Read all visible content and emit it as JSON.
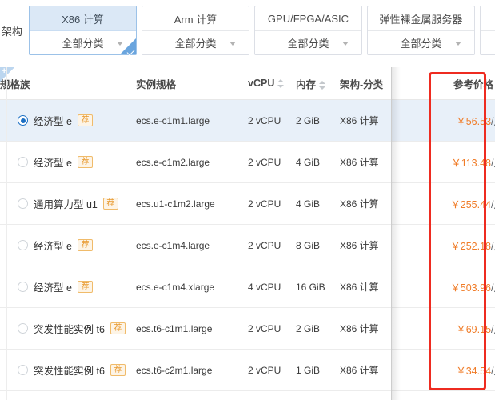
{
  "arch_filter": {
    "row_label": "架构",
    "cards": [
      {
        "title": "X86 计算",
        "category_label": "全部分类",
        "selected": true,
        "caret_icon": "chevron-down-icon"
      },
      {
        "title": "Arm 计算",
        "category_label": "全部分类",
        "selected": false,
        "caret_icon": "chevron-down-icon"
      },
      {
        "title": "GPU/FPGA/ASIC",
        "category_label": "全部分类",
        "selected": false,
        "caret_icon": "chevron-down-icon"
      },
      {
        "title": "弹性裸金属服务器",
        "category_label": "全部分类",
        "selected": false,
        "caret_icon": "chevron-down-icon"
      }
    ]
  },
  "table": {
    "columns": {
      "family": "规格族",
      "spec": "实例规格",
      "vcpu": "vCPU",
      "memory": "内存",
      "arch_category": "架构-分类",
      "price": "参考价格"
    },
    "sort_icon": "sort-updown-icon",
    "badge_text": "荐",
    "row_add_icon": "plus-icon",
    "rows": [
      {
        "selected": true,
        "family": "经济型 e",
        "badge": "荐",
        "spec": "ecs.e-c1m1.large",
        "vcpu": "2 vCPU",
        "memory": "2 GiB",
        "arch": "X86 计算",
        "price_amount": "￥56.53",
        "price_unit": "/月"
      },
      {
        "selected": false,
        "family": "经济型 e",
        "badge": "荐",
        "spec": "ecs.e-c1m2.large",
        "vcpu": "2 vCPU",
        "memory": "4 GiB",
        "arch": "X86 计算",
        "price_amount": "￥113.48",
        "price_unit": "/月"
      },
      {
        "selected": false,
        "family": "通用算力型 u1",
        "badge": "荐",
        "spec": "ecs.u1-c1m2.large",
        "vcpu": "2 vCPU",
        "memory": "4 GiB",
        "arch": "X86 计算",
        "price_amount": "￥255.44",
        "price_unit": "/月"
      },
      {
        "selected": false,
        "family": "经济型 e",
        "badge": "荐",
        "spec": "ecs.e-c1m4.large",
        "vcpu": "2 vCPU",
        "memory": "8 GiB",
        "arch": "X86 计算",
        "price_amount": "￥252.18",
        "price_unit": "/月"
      },
      {
        "selected": false,
        "family": "经济型 e",
        "badge": "荐",
        "spec": "ecs.e-c1m4.xlarge",
        "vcpu": "4 vCPU",
        "memory": "16 GiB",
        "arch": "X86 计算",
        "price_amount": "￥503.96",
        "price_unit": "/月"
      },
      {
        "selected": false,
        "family": "突发性能实例 t6",
        "badge": "荐",
        "spec": "ecs.t6-c1m1.large",
        "vcpu": "2 vCPU",
        "memory": "2 GiB",
        "arch": "X86 计算",
        "price_amount": "￥69.15",
        "price_unit": "/月"
      },
      {
        "selected": false,
        "family": "突发性能实例 t6",
        "badge": "荐",
        "spec": "ecs.t6-c2m1.large",
        "vcpu": "2 vCPU",
        "memory": "1 GiB",
        "arch": "X86 计算",
        "price_amount": "￥34.54",
        "price_unit": "/月"
      }
    ]
  },
  "annotation": {
    "price_highlight_color": "#ee2b20"
  }
}
